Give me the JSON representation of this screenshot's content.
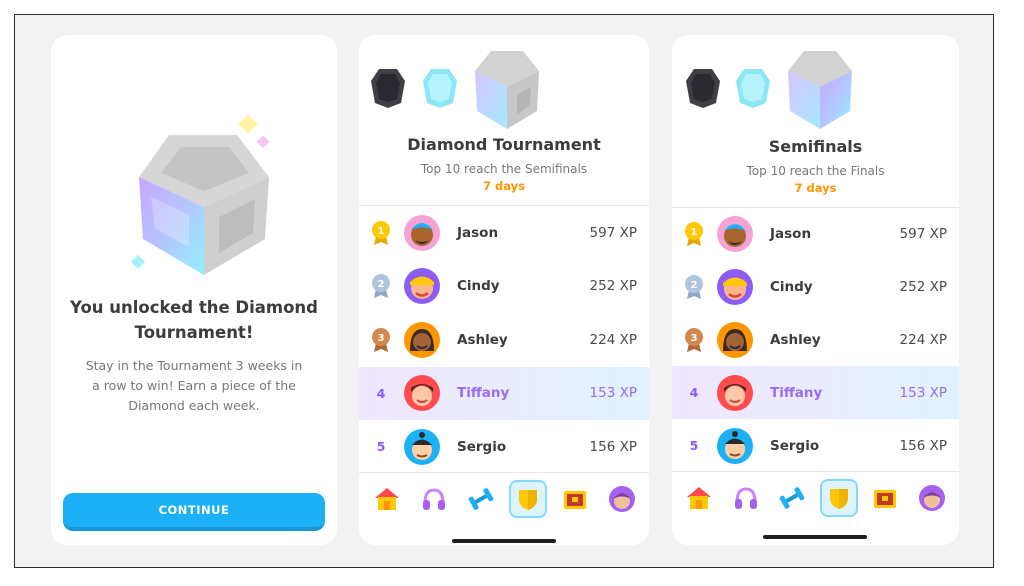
{
  "panel1": {
    "title": "You unlocked the Diamond Tournament!",
    "description": "Stay in the Tournament 3 weeks in a row to win! Earn a piece of the Diamond each week.",
    "continue_label": "CONTINUE"
  },
  "panel2": {
    "title": "Diamond Tournament",
    "subtitle": "Top 10 reach the Semifinals",
    "days": "7 days",
    "rows": [
      {
        "rank": "1",
        "name": "Jason",
        "xp": "597 XP"
      },
      {
        "rank": "2",
        "name": "Cindy",
        "xp": "252 XP"
      },
      {
        "rank": "3",
        "name": "Ashley",
        "xp": "224 XP"
      },
      {
        "rank": "4",
        "name": "Tiffany",
        "xp": "153 XP"
      },
      {
        "rank": "5",
        "name": "Sergio",
        "xp": "156 XP"
      }
    ]
  },
  "panel3": {
    "title": "Semifinals",
    "subtitle": "Top 10 reach the Finals",
    "days": "7 days",
    "rows": [
      {
        "rank": "1",
        "name": "Jason",
        "xp": "597 XP"
      },
      {
        "rank": "2",
        "name": "Cindy",
        "xp": "252 XP"
      },
      {
        "rank": "3",
        "name": "Ashley",
        "xp": "224 XP"
      },
      {
        "rank": "4",
        "name": "Tiffany",
        "xp": "153 XP"
      },
      {
        "rank": "5",
        "name": "Sergio",
        "xp": "156 XP"
      }
    ]
  },
  "tabs": [
    "home-icon",
    "headphones-icon",
    "dumbbell-icon",
    "league-shield-icon",
    "treasure-chest-icon",
    "profile-avatar-icon"
  ],
  "colors": {
    "accent_blue": "#1cb0f6",
    "orange": "#ff9600",
    "highlight_purple": "#9b6bf2",
    "gold": "#ffc800",
    "silver": "#b0c4de",
    "bronze": "#d2884f"
  }
}
